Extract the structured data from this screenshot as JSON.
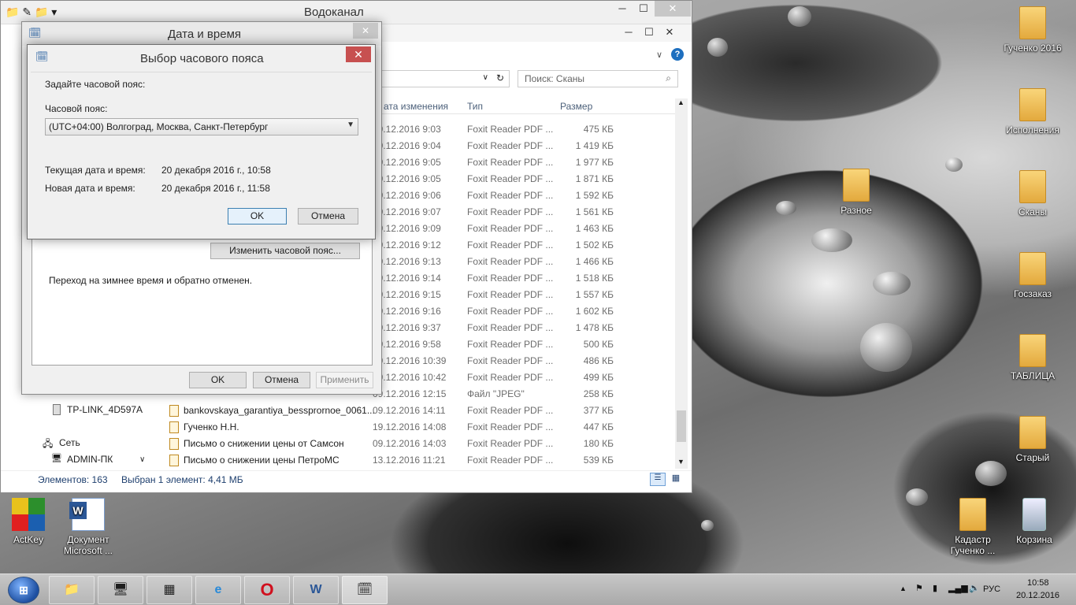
{
  "explorer": {
    "title": "Водоканал",
    "search_placeholder": "Поиск: Сканы",
    "columns": {
      "date": "ата изменения",
      "type": "Тип",
      "size": "Размер"
    },
    "rows": [
      {
        "name": "",
        "date": "09.12.2016 9:03",
        "type": "Foxit Reader PDF ...",
        "size": "475 КБ"
      },
      {
        "name": "",
        "date": "09.12.2016 9:04",
        "type": "Foxit Reader PDF ...",
        "size": "1 419 КБ"
      },
      {
        "name": "",
        "date": "09.12.2016 9:05",
        "type": "Foxit Reader PDF ...",
        "size": "1 977 КБ"
      },
      {
        "name": "",
        "date": "09.12.2016 9:05",
        "type": "Foxit Reader PDF ...",
        "size": "1 871 КБ"
      },
      {
        "name": "",
        "date": "09.12.2016 9:06",
        "type": "Foxit Reader PDF ...",
        "size": "1 592 КБ"
      },
      {
        "name": "",
        "date": "09.12.2016 9:07",
        "type": "Foxit Reader PDF ...",
        "size": "1 561 КБ"
      },
      {
        "name": "",
        "date": "09.12.2016 9:09",
        "type": "Foxit Reader PDF ...",
        "size": "1 463 КБ"
      },
      {
        "name": "",
        "date": "09.12.2016 9:12",
        "type": "Foxit Reader PDF ...",
        "size": "1 502 КБ"
      },
      {
        "name": "",
        "date": "09.12.2016 9:13",
        "type": "Foxit Reader PDF ...",
        "size": "1 466 КБ"
      },
      {
        "name": "",
        "date": "09.12.2016 9:14",
        "type": "Foxit Reader PDF ...",
        "size": "1 518 КБ"
      },
      {
        "name": "",
        "date": "09.12.2016 9:15",
        "type": "Foxit Reader PDF ...",
        "size": "1 557 КБ"
      },
      {
        "name": "",
        "date": "09.12.2016 9:16",
        "type": "Foxit Reader PDF ...",
        "size": "1 602 КБ"
      },
      {
        "name": "",
        "date": "09.12.2016 9:37",
        "type": "Foxit Reader PDF ...",
        "size": "1 478 КБ"
      },
      {
        "name": "",
        "date": "09.12.2016 9:58",
        "type": "Foxit Reader PDF ...",
        "size": "500 КБ"
      },
      {
        "name": "",
        "date": "09.12.2016 10:39",
        "type": "Foxit Reader PDF ...",
        "size": "486 КБ"
      },
      {
        "name": "",
        "date": "09.12.2016 10:42",
        "type": "Foxit Reader PDF ...",
        "size": "499 КБ"
      },
      {
        "name": "",
        "date": "09.12.2016 12:15",
        "type": "Файл \"JPEG\"",
        "size": "258 КБ"
      },
      {
        "name": "bankovskaya_garantiya_bessprornoe_0061...",
        "date": "09.12.2016 14:11",
        "type": "Foxit Reader PDF ...",
        "size": "377 КБ"
      },
      {
        "name": "Гученко Н.Н.",
        "date": "19.12.2016 14:08",
        "type": "Foxit Reader PDF ...",
        "size": "447 КБ"
      },
      {
        "name": "Письмо о снижении цены от Самсон",
        "date": "09.12.2016 14:03",
        "type": "Foxit Reader PDF ...",
        "size": "180 КБ"
      },
      {
        "name": "Письмо о снижении цены ПетроМС",
        "date": "13.12.2016 11:21",
        "type": "Foxit Reader PDF ...",
        "size": "539 КБ"
      }
    ],
    "nav": {
      "item1": "TP-LINK_4D597A",
      "item2": "Сеть",
      "item3": "ADMIN-ПК"
    },
    "status": {
      "count": "Элементов: 163",
      "selected": "Выбран 1 элемент: 4,41 МБ"
    }
  },
  "datetime_dialog": {
    "title": "Дата и время",
    "change_tz_button": "Изменить часовой пояс...",
    "dst_note": "Переход на зимнее время и обратно отменен.",
    "ok": "OK",
    "cancel": "Отмена",
    "apply": "Применить"
  },
  "tz_dialog": {
    "title": "Выбор часового пояса",
    "prompt": "Задайте часовой пояс:",
    "tz_label": "Часовой пояс:",
    "tz_value": "(UTC+04:00) Волгоград, Москва, Санкт-Петербург",
    "current_label": "Текущая дата и время:",
    "current_value": "20 декабря 2016 г., 10:58",
    "new_label": "Новая дата и время:",
    "new_value": "20 декабря 2016 г., 11:58",
    "ok": "OK",
    "cancel": "Отмена"
  },
  "desktop_icons": {
    "guchenko": "Гученко 2016",
    "ispolneniya": "Исполнения",
    "raznoe": "Разное",
    "skany": "Сканы",
    "goszakaz": "Госзаказ",
    "tablica": "ТАБЛИЦА",
    "stary": "Старый",
    "actkey": "ActKey",
    "document": "Документ Microsoft ...",
    "kadastr": "Кадастр Гученко ...",
    "korzina": "Корзина"
  },
  "taskbar": {
    "lang": "РУС",
    "time": "10:58",
    "date": "20.12.2016"
  }
}
